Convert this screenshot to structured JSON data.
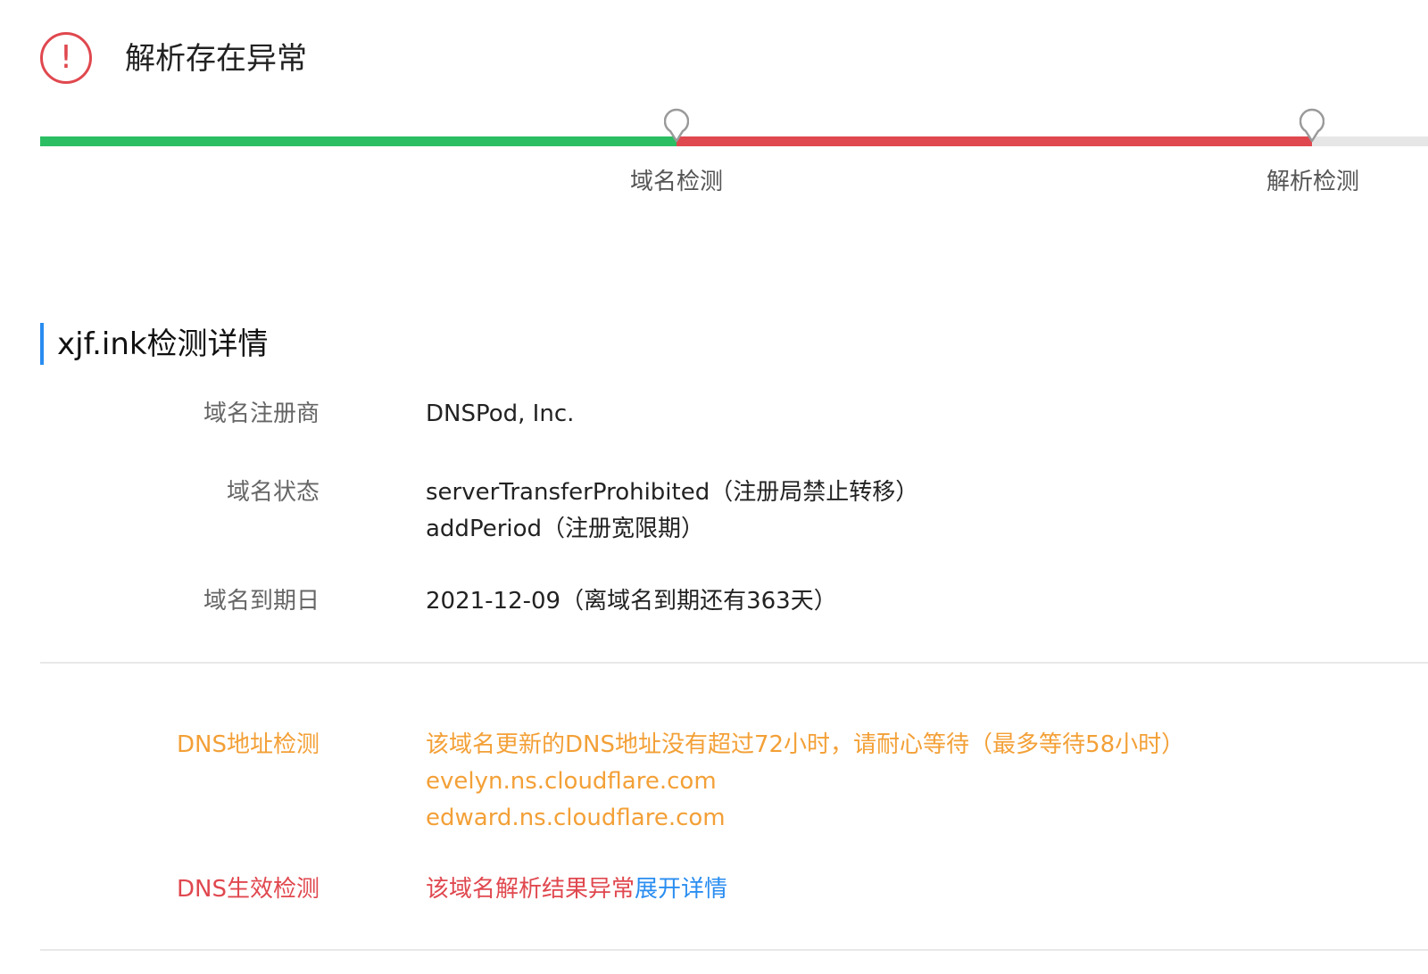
{
  "status": {
    "icon": "exclamation-circle-icon",
    "icon_glyph": "!",
    "title": "解析存在异常",
    "color": "#e0484f"
  },
  "progress": {
    "colors": {
      "done": "#2cbe63",
      "error": "#e0484f",
      "pending": "#e6e6e6"
    },
    "steps": [
      {
        "label": "域名检测",
        "state": "done"
      },
      {
        "label": "解析检测",
        "state": "error"
      }
    ]
  },
  "details": {
    "title": "xjf.ink检测详情",
    "accent": "#2a8df0",
    "registrar": {
      "label": "域名注册商",
      "value": "DNSPod, Inc."
    },
    "status": {
      "label": "域名状态",
      "values": [
        "serverTransferProhibited（注册局禁止转移）",
        "addPeriod（注册宽限期）"
      ]
    },
    "expiry": {
      "label": "域名到期日",
      "value": "2021-12-09（离域名到期还有363天）"
    }
  },
  "checks": {
    "dns_address": {
      "label": "DNS地址检测",
      "color": "#f3a037",
      "message": "该域名更新的DNS地址没有超过72小时，请耐心等待（最多等待58小时）",
      "nameservers": [
        "evelyn.ns.cloudflare.com",
        "edward.ns.cloudflare.com"
      ]
    },
    "dns_effect": {
      "label": "DNS生效检测",
      "color": "#e0484f",
      "message": "该域名解析结果异常",
      "link": "展开详情"
    }
  }
}
